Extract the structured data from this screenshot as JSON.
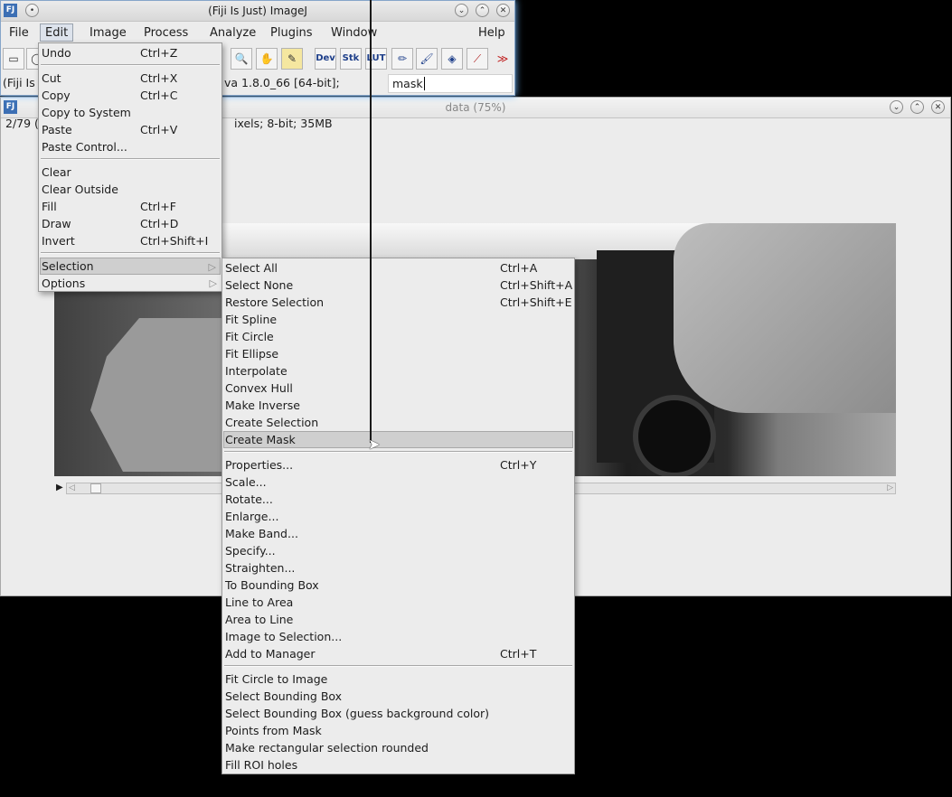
{
  "main_window": {
    "title": "(Fiji Is Just) ImageJ",
    "menus": [
      "File",
      "Edit",
      "Image",
      "Process",
      "Analyze",
      "Plugins",
      "Window",
      "Help"
    ],
    "toolbar": {
      "tools": [
        "rectangle-icon",
        "oval-icon",
        "magnifier-icon",
        "hand-icon",
        "color-picker-icon"
      ],
      "text_tools": [
        "Dev",
        "Stk",
        "LUT"
      ],
      "more": "≫"
    },
    "status_left": "(Fiji Is J",
    "status_right": "va 1.8.0_66 [64-bit];",
    "search_value": "mask"
  },
  "image_window": {
    "title": "data (75%)",
    "info_left": "2/79 (",
    "info_right": "ixels; 8-bit; 35MB"
  },
  "edit_menu": {
    "items": [
      {
        "label": "Undo",
        "shortcut": "Ctrl+Z"
      },
      {
        "label": "Cut",
        "shortcut": "Ctrl+X"
      },
      {
        "label": "Copy",
        "shortcut": "Ctrl+C"
      },
      {
        "label": "Copy to System",
        "shortcut": ""
      },
      {
        "label": "Paste",
        "shortcut": "Ctrl+V"
      },
      {
        "label": "Paste Control...",
        "shortcut": ""
      },
      {
        "label": "Clear",
        "shortcut": ""
      },
      {
        "label": "Clear Outside",
        "shortcut": ""
      },
      {
        "label": "Fill",
        "shortcut": "Ctrl+F"
      },
      {
        "label": "Draw",
        "shortcut": "Ctrl+D"
      },
      {
        "label": "Invert",
        "shortcut": "Ctrl+Shift+I"
      },
      {
        "label": "Selection",
        "shortcut": ""
      },
      {
        "label": "Options",
        "shortcut": ""
      }
    ]
  },
  "selection_menu": {
    "items": [
      {
        "label": "Select All",
        "shortcut": "Ctrl+A"
      },
      {
        "label": "Select None",
        "shortcut": "Ctrl+Shift+A"
      },
      {
        "label": "Restore Selection",
        "shortcut": "Ctrl+Shift+E"
      },
      {
        "label": "Fit Spline",
        "shortcut": ""
      },
      {
        "label": "Fit Circle",
        "shortcut": ""
      },
      {
        "label": "Fit Ellipse",
        "shortcut": ""
      },
      {
        "label": "Interpolate",
        "shortcut": ""
      },
      {
        "label": "Convex Hull",
        "shortcut": ""
      },
      {
        "label": "Make Inverse",
        "shortcut": ""
      },
      {
        "label": "Create Selection",
        "shortcut": ""
      },
      {
        "label": "Create Mask",
        "shortcut": ""
      },
      {
        "label": "Properties...",
        "shortcut": "Ctrl+Y"
      },
      {
        "label": "Scale...",
        "shortcut": ""
      },
      {
        "label": "Rotate...",
        "shortcut": ""
      },
      {
        "label": "Enlarge...",
        "shortcut": ""
      },
      {
        "label": "Make Band...",
        "shortcut": ""
      },
      {
        "label": "Specify...",
        "shortcut": ""
      },
      {
        "label": "Straighten...",
        "shortcut": ""
      },
      {
        "label": "To Bounding Box",
        "shortcut": ""
      },
      {
        "label": "Line to Area",
        "shortcut": ""
      },
      {
        "label": "Area to Line",
        "shortcut": ""
      },
      {
        "label": "Image to Selection...",
        "shortcut": ""
      },
      {
        "label": "Add to Manager",
        "shortcut": "Ctrl+T"
      },
      {
        "label": "Fit Circle to Image",
        "shortcut": ""
      },
      {
        "label": "Select Bounding Box",
        "shortcut": ""
      },
      {
        "label": "Select Bounding Box (guess background color)",
        "shortcut": ""
      },
      {
        "label": "Points from Mask",
        "shortcut": ""
      },
      {
        "label": "Make rectangular selection rounded",
        "shortcut": ""
      },
      {
        "label": "Fill ROI holes",
        "shortcut": ""
      }
    ]
  }
}
